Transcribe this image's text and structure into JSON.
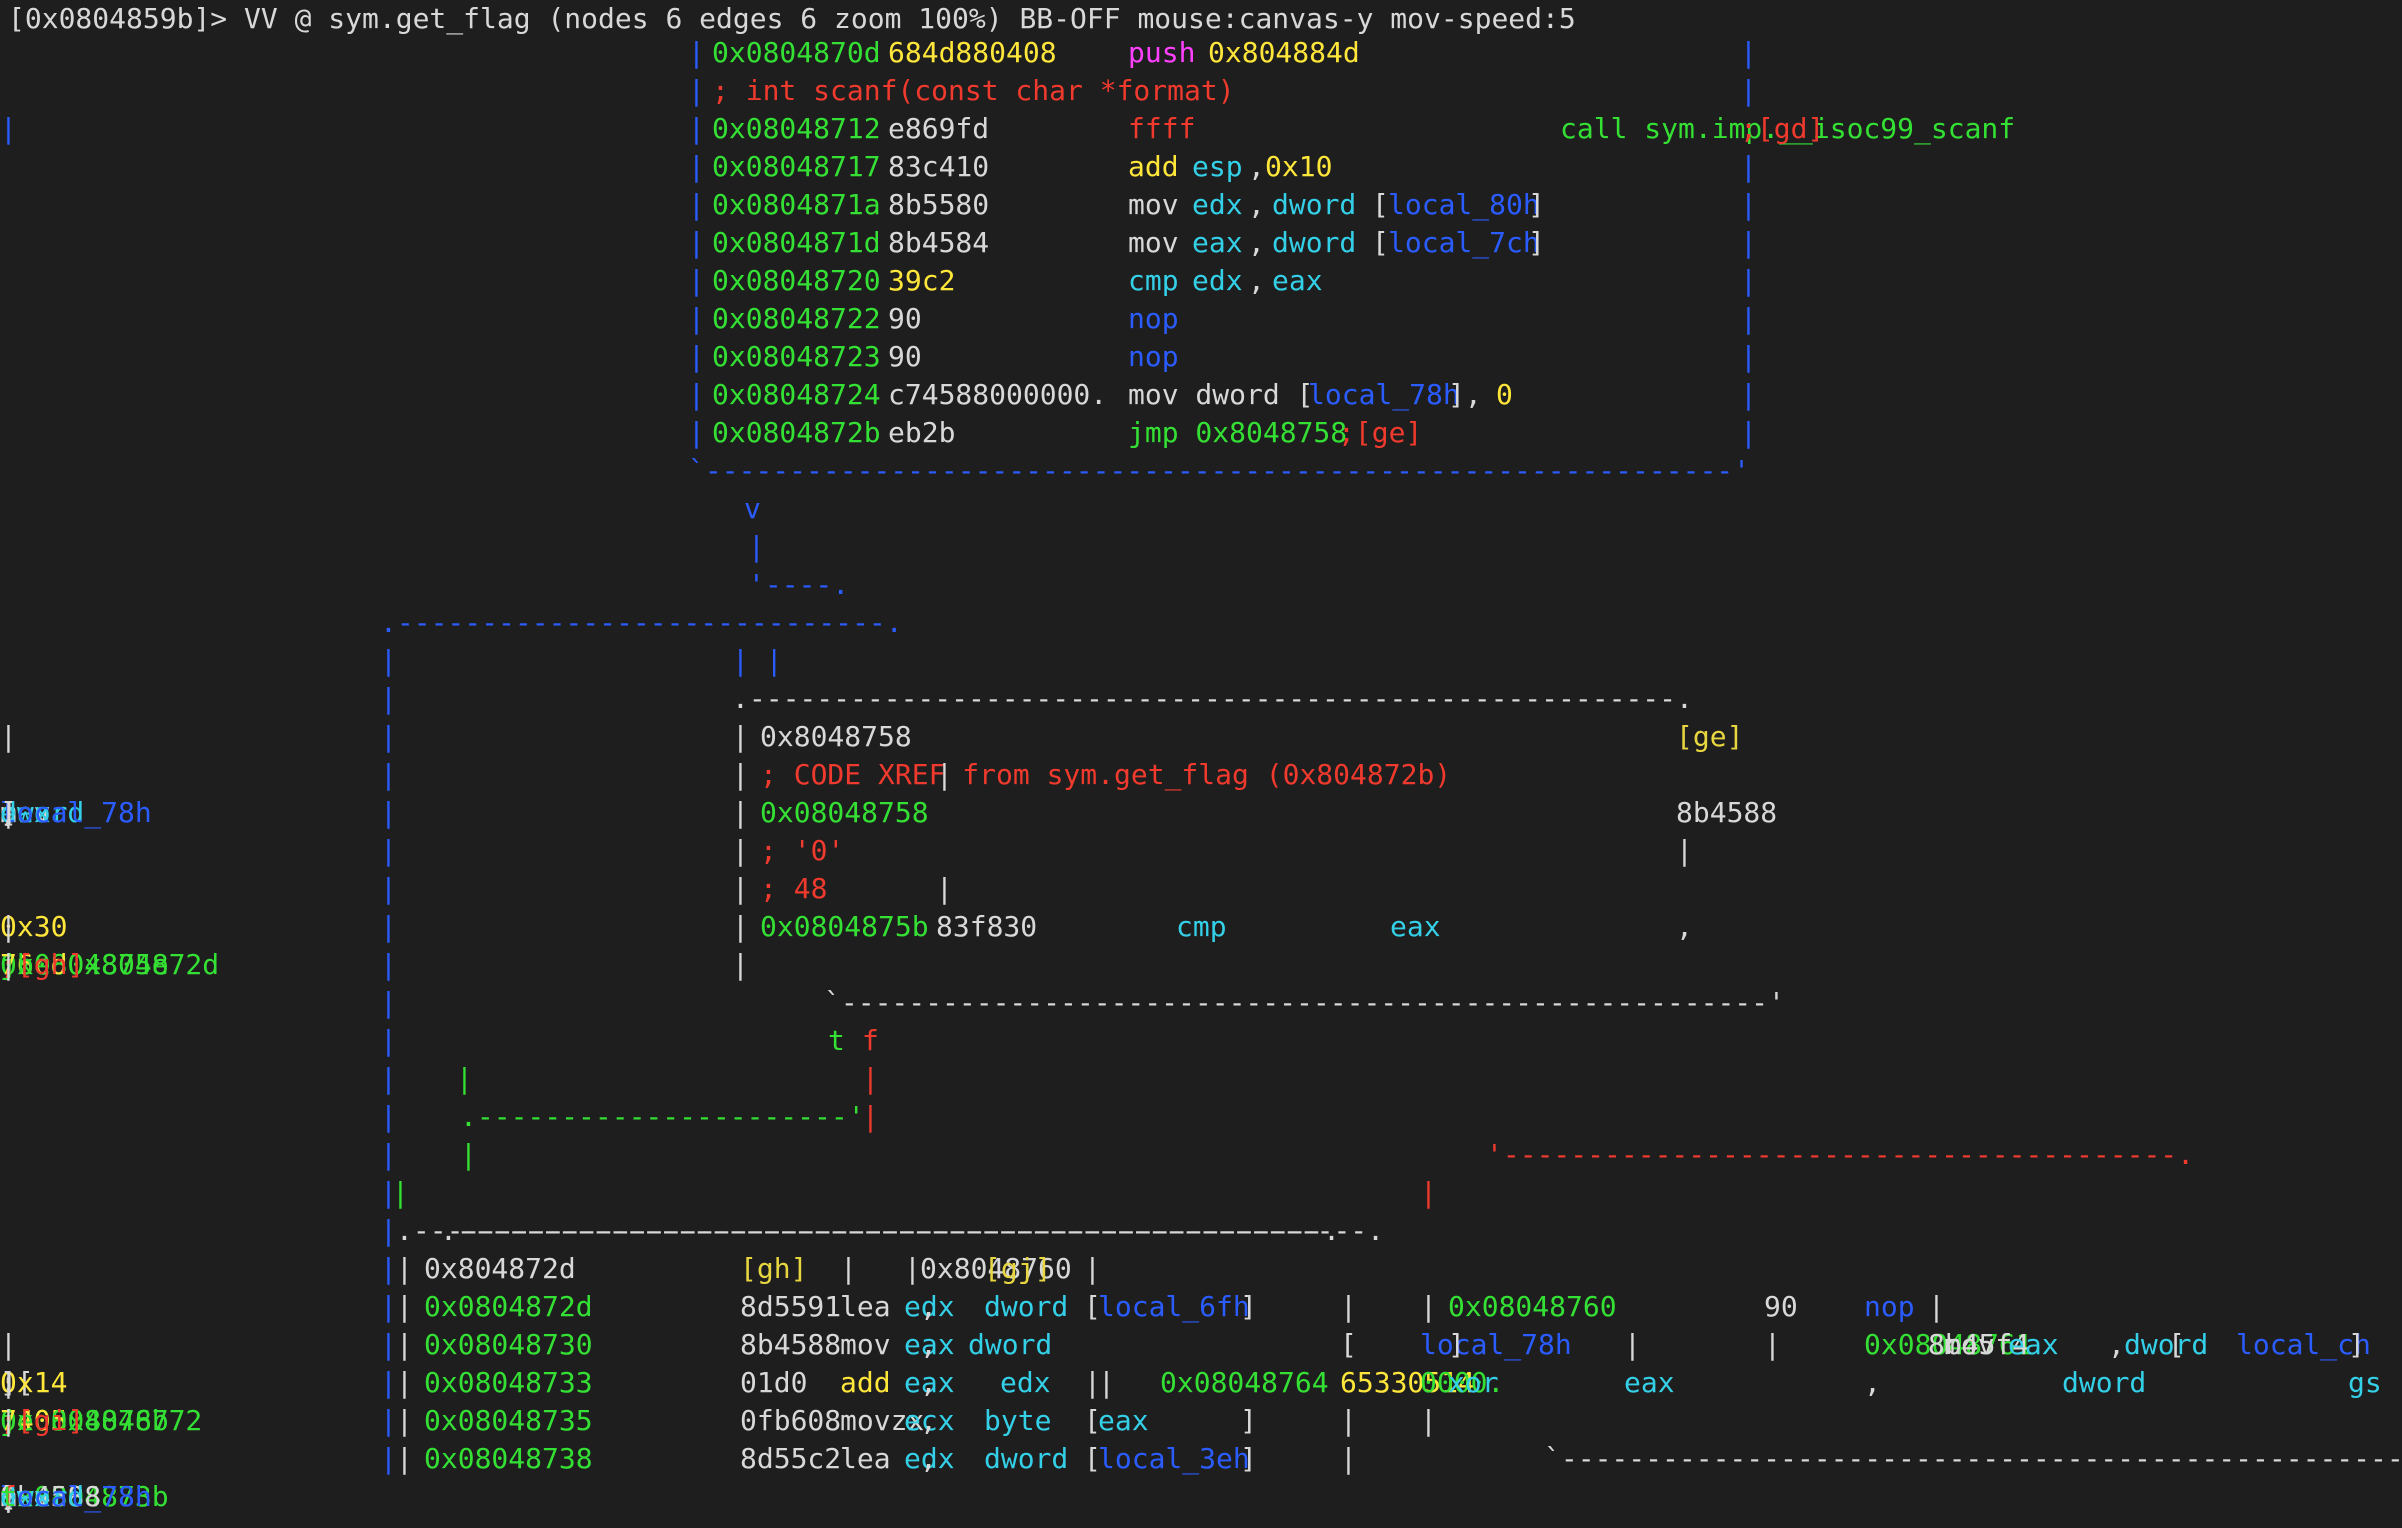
{
  "status_bar": "[0x0804859b]> VV @ sym.get_flag (nodes 6 edges 6 zoom 100%) BB-OFF mouse:canvas-y mov-speed:5",
  "colors": {
    "background": "#1e1e1e",
    "address": "#34e034",
    "comment": "#f03a2e",
    "border_blue": "#2a5cff",
    "register": "#34d0e8",
    "immediate": "#ffe63a",
    "push": "#ff40ff"
  },
  "lines": [
    [
      {
        "c": "b",
        "t": "|"
      },
      {
        "c": "g",
        "t": "0x0804870d"
      },
      {
        "c": "y",
        "t": "684d880408"
      },
      {
        "c": "m",
        "t": "push"
      },
      {
        "c": "y",
        "t": "0x804884d"
      },
      {
        "c": "b",
        "t": "|"
      }
    ],
    [
      {
        "c": "b",
        "t": "|"
      },
      {
        "c": "r",
        "t": "; int scanf(const char *format)"
      },
      {
        "c": "b",
        "t": "|"
      }
    ],
    [
      {
        "c": "b",
        "t": "|"
      },
      {
        "c": "g",
        "t": "0x08048712"
      },
      {
        "c": "w",
        "t": "e869fd"
      },
      {
        "c": "r",
        "t": "ffff"
      },
      {
        "c": "g",
        "t": "call sym.imp.__isoc99_scanf"
      },
      {
        "c": "r",
        "t": ";[gd]"
      },
      {
        "c": "b",
        "t": "|"
      }
    ],
    [
      {
        "c": "b",
        "t": "|"
      },
      {
        "c": "g",
        "t": "0x08048717"
      },
      {
        "c": "w",
        "t": "83c410"
      },
      {
        "c": "y",
        "t": "add"
      },
      {
        "c": "c",
        "t": "esp"
      },
      {
        "c": "w",
        "t": ","
      },
      {
        "c": "y",
        "t": "0x10"
      },
      {
        "c": "b",
        "t": "|"
      }
    ],
    [
      {
        "c": "b",
        "t": "|"
      },
      {
        "c": "g",
        "t": "0x0804871a"
      },
      {
        "c": "w",
        "t": "8b5580"
      },
      {
        "c": "w",
        "t": "mov"
      },
      {
        "c": "c",
        "t": "edx"
      },
      {
        "c": "w",
        "t": ","
      },
      {
        "c": "c",
        "t": "dword"
      },
      {
        "c": "w",
        "t": "["
      },
      {
        "c": "b",
        "t": "local_80h"
      },
      {
        "c": "w",
        "t": "]"
      },
      {
        "c": "b",
        "t": "|"
      }
    ],
    [
      {
        "c": "b",
        "t": "|"
      },
      {
        "c": "g",
        "t": "0x0804871d"
      },
      {
        "c": "w",
        "t": "8b4584"
      },
      {
        "c": "w",
        "t": "mov"
      },
      {
        "c": "c",
        "t": "eax"
      },
      {
        "c": "w",
        "t": ","
      },
      {
        "c": "c",
        "t": "dword"
      },
      {
        "c": "w",
        "t": "["
      },
      {
        "c": "b",
        "t": "local_7ch"
      },
      {
        "c": "w",
        "t": "]"
      },
      {
        "c": "b",
        "t": "|"
      }
    ],
    [
      {
        "c": "b",
        "t": "|"
      },
      {
        "c": "g",
        "t": "0x08048720"
      },
      {
        "c": "y",
        "t": "39c2"
      },
      {
        "c": "c",
        "t": "cmp"
      },
      {
        "c": "c",
        "t": "edx"
      },
      {
        "c": "w",
        "t": ","
      },
      {
        "c": "c",
        "t": "eax"
      },
      {
        "c": "b",
        "t": "|"
      }
    ],
    [
      {
        "c": "b",
        "t": "|"
      },
      {
        "c": "g",
        "t": "0x08048722"
      },
      {
        "c": "w",
        "t": "90"
      },
      {
        "c": "b",
        "t": "nop"
      },
      {
        "c": "b",
        "t": "|"
      }
    ],
    [
      {
        "c": "b",
        "t": "|"
      },
      {
        "c": "g",
        "t": "0x08048723"
      },
      {
        "c": "w",
        "t": "90"
      },
      {
        "c": "b",
        "t": "nop"
      },
      {
        "c": "b",
        "t": "|"
      }
    ],
    [
      {
        "c": "b",
        "t": "|"
      },
      {
        "c": "g",
        "t": "0x08048724"
      },
      {
        "c": "w",
        "t": "c74588000000."
      },
      {
        "c": "w",
        "t": "mov dword ["
      },
      {
        "c": "b",
        "t": "local_78h"
      },
      {
        "c": "w",
        "t": "],"
      },
      {
        "c": "y",
        "t": "0"
      },
      {
        "c": "b",
        "t": "|"
      }
    ],
    [
      {
        "c": "b",
        "t": "|"
      },
      {
        "c": "g",
        "t": "0x0804872b"
      },
      {
        "c": "w",
        "t": "eb2b"
      },
      {
        "c": "g",
        "t": "jmp 0x8048758"
      },
      {
        "c": "r",
        "t": ";[ge]"
      },
      {
        "c": "b",
        "t": "|"
      }
    ],
    [
      {
        "c": "b",
        "t": "`-------------------------------------------------------------'"
      }
    ],
    [
      {
        "c": "b",
        "t": "v"
      }
    ],
    [
      {
        "c": "b",
        "t": "|"
      }
    ],
    [
      {
        "c": "b",
        "t": "'----."
      }
    ],
    [
      {
        "c": "b",
        "t": ".-----------------------------."
      }
    ],
    [
      {
        "c": "b",
        "t": "|"
      },
      {
        "c": "b",
        "t": "| |"
      }
    ],
    [
      {
        "c": "b",
        "t": "|"
      },
      {
        "c": "w",
        "t": ".-------------------------------------------------------."
      }
    ],
    [
      {
        "c": "b",
        "t": "|"
      },
      {
        "c": "w",
        "t": "|"
      },
      {
        "c": "w",
        "t": "0x8048758"
      },
      {
        "c": "yc",
        "t": "[ge]"
      },
      {
        "c": "w",
        "t": "|"
      }
    ],
    [
      {
        "c": "b",
        "t": "|"
      },
      {
        "c": "w",
        "t": "|"
      },
      {
        "c": "r",
        "t": "; CODE XREF from sym.get_flag (0x804872b)"
      },
      {
        "c": "w",
        "t": "|"
      }
    ],
    [
      {
        "c": "b",
        "t": "|"
      },
      {
        "c": "w",
        "t": "|"
      },
      {
        "c": "g",
        "t": "0x08048758"
      },
      {
        "c": "w",
        "t": "8b4588"
      },
      {
        "c": "w",
        "t": "mov"
      },
      {
        "c": "c",
        "t": "eax"
      },
      {
        "c": "w",
        "t": ","
      },
      {
        "c": "c",
        "t": "dword"
      },
      {
        "c": "w",
        "t": "["
      },
      {
        "c": "b",
        "t": "local_78h"
      },
      {
        "c": "w",
        "t": "]"
      },
      {
        "c": "w",
        "t": "|"
      }
    ],
    [
      {
        "c": "b",
        "t": "|"
      },
      {
        "c": "w",
        "t": "|"
      },
      {
        "c": "r",
        "t": "; '0'"
      },
      {
        "c": "w",
        "t": "|"
      }
    ],
    [
      {
        "c": "b",
        "t": "|"
      },
      {
        "c": "w",
        "t": "|"
      },
      {
        "c": "r",
        "t": "; 48"
      },
      {
        "c": "w",
        "t": "|"
      }
    ],
    [
      {
        "c": "b",
        "t": "|"
      },
      {
        "c": "w",
        "t": "|"
      },
      {
        "c": "g",
        "t": "0x0804875b"
      },
      {
        "c": "w",
        "t": "83f830"
      },
      {
        "c": "c",
        "t": "cmp"
      },
      {
        "c": "c",
        "t": "eax"
      },
      {
        "c": "w",
        "t": ","
      },
      {
        "c": "y",
        "t": "0x30"
      },
      {
        "c": "w",
        "t": "|"
      }
    ],
    [
      {
        "c": "b",
        "t": "|"
      },
      {
        "c": "w",
        "t": "|"
      },
      {
        "c": "g",
        "t": "0x0804875e"
      },
      {
        "c": "y",
        "t": "76cd"
      },
      {
        "c": "g",
        "t": "jbe 0x804872d"
      },
      {
        "c": "r",
        "t": ";[gh]"
      },
      {
        "c": "w",
        "t": "|"
      }
    ],
    [
      {
        "c": "b",
        "t": "|"
      },
      {
        "c": "w",
        "t": "`-------------------------------------------------------'"
      }
    ],
    [
      {
        "c": "b",
        "t": "|"
      },
      {
        "c": "g",
        "t": "t"
      },
      {
        "c": "r",
        "t": "f"
      }
    ],
    [
      {
        "c": "b",
        "t": "|"
      },
      {
        "c": "g",
        "t": "|"
      },
      {
        "c": "r",
        "t": "|"
      }
    ],
    [
      {
        "c": "b",
        "t": "|"
      },
      {
        "c": "g",
        "t": ".----------------------'"
      },
      {
        "c": "r",
        "t": "|"
      }
    ],
    [
      {
        "c": "b",
        "t": "|"
      },
      {
        "c": "g",
        "t": "|"
      },
      {
        "c": "r",
        "t": "'----------------------------------------."
      }
    ],
    [
      {
        "c": "b",
        "t": "|"
      },
      {
        "c": "g",
        "t": "|"
      },
      {
        "c": "r",
        "t": "|"
      }
    ],
    [
      {
        "c": "b",
        "t": "|"
      },
      {
        "c": "w",
        "t": ".------------------------------------------------------."
      },
      {
        "c": "w",
        "t": ".------------------------------------------------------."
      }
    ],
    [
      {
        "c": "b",
        "t": "|"
      },
      {
        "c": "w",
        "t": "|"
      },
      {
        "c": "w",
        "t": "0x804872d"
      },
      {
        "c": "yc",
        "t": "[gh]"
      },
      {
        "c": "w",
        "t": "|"
      },
      {
        "c": "w",
        "t": "|"
      },
      {
        "c": "w",
        "t": "0x8048760"
      },
      {
        "c": "yc",
        "t": "[gj]"
      },
      {
        "c": "w",
        "t": "|"
      }
    ],
    [
      {
        "c": "b",
        "t": "|"
      },
      {
        "c": "w",
        "t": "|"
      },
      {
        "c": "g",
        "t": "0x0804872d"
      },
      {
        "c": "w",
        "t": "8d5591"
      },
      {
        "c": "w",
        "t": "lea"
      },
      {
        "c": "c",
        "t": "edx"
      },
      {
        "c": "w",
        "t": ","
      },
      {
        "c": "c",
        "t": "dword"
      },
      {
        "c": "w",
        "t": "["
      },
      {
        "c": "b",
        "t": "local_6fh"
      },
      {
        "c": "w",
        "t": "]"
      },
      {
        "c": "w",
        "t": "|"
      },
      {
        "c": "w",
        "t": "|"
      },
      {
        "c": "g",
        "t": "0x08048760"
      },
      {
        "c": "w",
        "t": "90"
      },
      {
        "c": "b",
        "t": "nop"
      },
      {
        "c": "w",
        "t": "|"
      }
    ],
    [
      {
        "c": "b",
        "t": "|"
      },
      {
        "c": "w",
        "t": "|"
      },
      {
        "c": "g",
        "t": "0x08048730"
      },
      {
        "c": "w",
        "t": "8b4588"
      },
      {
        "c": "w",
        "t": "mov"
      },
      {
        "c": "c",
        "t": "eax"
      },
      {
        "c": "w",
        "t": ","
      },
      {
        "c": "c",
        "t": "dword"
      },
      {
        "c": "w",
        "t": "["
      },
      {
        "c": "b",
        "t": "local_78h"
      },
      {
        "c": "w",
        "t": "]"
      },
      {
        "c": "w",
        "t": "|"
      },
      {
        "c": "w",
        "t": "|"
      },
      {
        "c": "g",
        "t": "0x08048761"
      },
      {
        "c": "w",
        "t": "8b45f4"
      },
      {
        "c": "w",
        "t": "mov"
      },
      {
        "c": "c",
        "t": "eax"
      },
      {
        "c": "w",
        "t": ","
      },
      {
        "c": "c",
        "t": "dword"
      },
      {
        "c": "w",
        "t": "["
      },
      {
        "c": "b",
        "t": "local_ch"
      },
      {
        "c": "w",
        "t": "]"
      },
      {
        "c": "w",
        "t": "|"
      }
    ],
    [
      {
        "c": "b",
        "t": "|"
      },
      {
        "c": "w",
        "t": "|"
      },
      {
        "c": "g",
        "t": "0x08048733"
      },
      {
        "c": "w",
        "t": "01d0"
      },
      {
        "c": "y",
        "t": "add"
      },
      {
        "c": "c",
        "t": "eax"
      },
      {
        "c": "w",
        "t": ","
      },
      {
        "c": "c",
        "t": "edx"
      },
      {
        "c": "w",
        "t": "|"
      },
      {
        "c": "w",
        "t": "|"
      },
      {
        "c": "g",
        "t": "0x08048764"
      },
      {
        "c": "y",
        "t": "65330514"
      },
      {
        "c": "g",
        "t": "0000."
      },
      {
        "c": "c",
        "t": "xor"
      },
      {
        "c": "c",
        "t": "eax"
      },
      {
        "c": "w",
        "t": ","
      },
      {
        "c": "c",
        "t": "dword"
      },
      {
        "c": "c",
        "t": "gs"
      },
      {
        "c": "w",
        "t": ":["
      },
      {
        "c": "y",
        "t": "0x14"
      },
      {
        "c": "w",
        "t": "]"
      },
      {
        "c": "w",
        "t": "|"
      }
    ],
    [
      {
        "c": "b",
        "t": "|"
      },
      {
        "c": "w",
        "t": "|"
      },
      {
        "c": "g",
        "t": "0x08048735"
      },
      {
        "c": "w",
        "t": "0fb608"
      },
      {
        "c": "w",
        "t": "movzx"
      },
      {
        "c": "c",
        "t": "ecx"
      },
      {
        "c": "w",
        "t": ","
      },
      {
        "c": "c",
        "t": "byte"
      },
      {
        "c": "w",
        "t": "["
      },
      {
        "c": "c",
        "t": "eax"
      },
      {
        "c": "w",
        "t": "]"
      },
      {
        "c": "w",
        "t": "|"
      },
      {
        "c": "w",
        "t": "|"
      },
      {
        "c": "g",
        "t": "0x0804876b"
      },
      {
        "c": "y",
        "t": "7405"
      },
      {
        "c": "g",
        "t": "je 0x8048772"
      },
      {
        "c": "r",
        "t": ";[gi]"
      },
      {
        "c": "w",
        "t": "|"
      }
    ],
    [
      {
        "c": "b",
        "t": "|"
      },
      {
        "c": "w",
        "t": "|"
      },
      {
        "c": "g",
        "t": "0x08048738"
      },
      {
        "c": "w",
        "t": "8d55c2"
      },
      {
        "c": "w",
        "t": "lea"
      },
      {
        "c": "c",
        "t": "edx"
      },
      {
        "c": "w",
        "t": ","
      },
      {
        "c": "c",
        "t": "dword"
      },
      {
        "c": "w",
        "t": "["
      },
      {
        "c": "b",
        "t": "local_3eh"
      },
      {
        "c": "w",
        "t": "]"
      },
      {
        "c": "w",
        "t": "|"
      },
      {
        "c": "w",
        "t": "`------------------------------------------------------'"
      }
    ],
    [
      {
        "c": "b",
        "t": "|"
      },
      {
        "c": "w",
        "t": "|"
      },
      {
        "c": "g",
        "t": "0x0804873b"
      },
      {
        "c": "w",
        "t": "8b4588"
      },
      {
        "c": "w",
        "t": "mov"
      },
      {
        "c": "c",
        "t": "eax"
      },
      {
        "c": "w",
        "t": ","
      },
      {
        "c": "c",
        "t": "dword"
      },
      {
        "c": "w",
        "t": "["
      },
      {
        "c": "b",
        "t": "local_78h"
      },
      {
        "c": "w",
        "t": "]"
      },
      {
        "c": "w",
        "t": "|"
      },
      {
        "c": "r",
        "t": "f"
      },
      {
        "c": "g",
        "t": "t"
      }
    ]
  ]
}
